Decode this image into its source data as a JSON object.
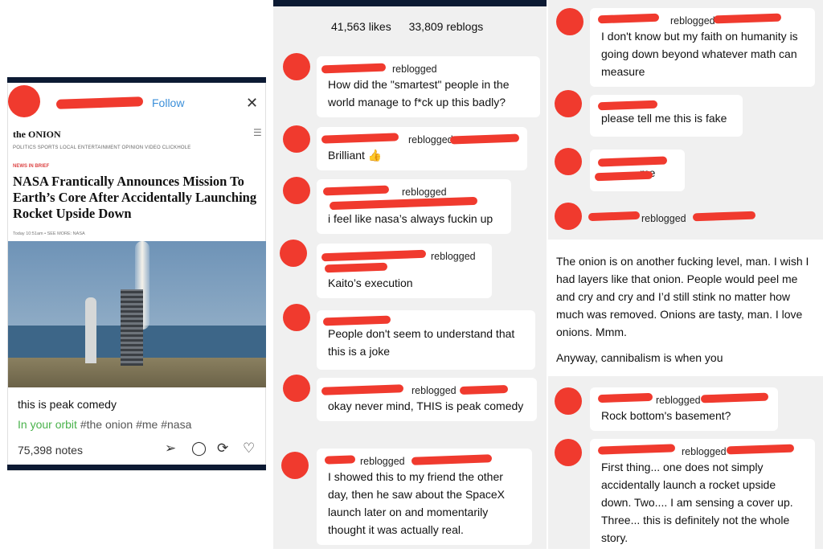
{
  "post": {
    "follow_label": "Follow",
    "close_label": "✕",
    "onion": {
      "logo": "the ONION",
      "nav": "POLITICS   SPORTS   LOCAL   ENTERTAINMENT   OPINION   VIDEO   CLICKHOLE",
      "tag": "NEWS IN BRIEF",
      "headline": "NASA Frantically Announces Mission To Earth’s Core After Accidentally Launching Rocket Upside Down",
      "date": "Today 10:51am  •  SEE MORE: NASA"
    },
    "caption": "this is peak comedy",
    "tags": {
      "orbit": "In your orbit",
      "list": "#the onion  #me  #nasa"
    },
    "notes": "75,398 notes"
  },
  "counts": {
    "likes": "41,563 likes",
    "reblogs": "33,809 reblogs"
  },
  "col2": [
    {
      "rb": "reblogged",
      "text": "How did the \"smartest\" people in the world manage to f*ck up this badly?"
    },
    {
      "rb": "reblogged",
      "text": "Brilliant 👍"
    },
    {
      "rb": "reblogged",
      "text": "i feel like nasa’s always fuckin up"
    },
    {
      "rb": "reblogged",
      "text": "Kaito’s execution"
    },
    {
      "rb": "",
      "text": "People don't seem to understand that this is a joke"
    },
    {
      "rb": "reblogged",
      "text": "okay never mind, THIS is peak comedy"
    },
    {
      "rb": "reblogged",
      "text": "I showed this to my friend the other day, then he saw about the SpaceX launch later on and momentarily thought it was actually real."
    }
  ],
  "col3": [
    {
      "rb": "reblogged",
      "text": "I don't know but my faith on humanity is going down beyond whatever math can measure"
    },
    {
      "rb": "",
      "text": "please tell me this is fake"
    },
    {
      "rb": "",
      "text": "me"
    },
    {
      "rb": "reblogged",
      "text": ""
    },
    {
      "rb": "reblogged",
      "text": "Rock bottom's basement?"
    },
    {
      "rb": "reblogged",
      "text": "First thing... one does not simply accidentally launch a rocket upside down.  Two.... I am sensing a cover up. Three... this is definitely not the whole story."
    }
  ],
  "col3_big": {
    "p1": "The onion is on another fucking level, man. I wish I had layers like that onion. People would peel me and cry and cry and I’d still stink no matter how much was removed. Onions are tasty, man. I love onions. Mmm.",
    "p2": "Anyway, cannibalism is when you"
  },
  "colors": {
    "redaction": "#f03a2e",
    "follow": "#3b8fd9",
    "orbit": "#49b24b",
    "bar": "#0c1a33"
  }
}
